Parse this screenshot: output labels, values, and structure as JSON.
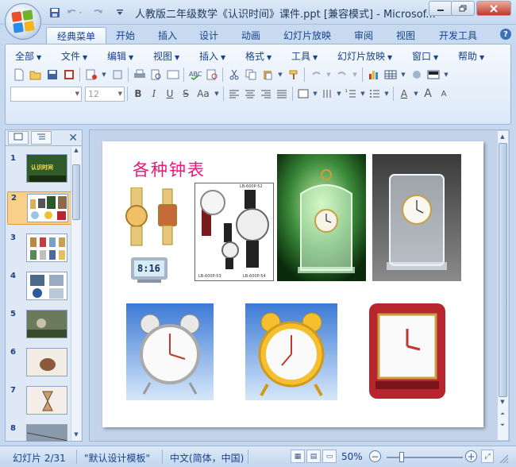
{
  "window": {
    "title": "人教版二年级数学《认识时间》课件.ppt [兼容模式] - Microsof..."
  },
  "qat": {
    "save_icon": "save-icon",
    "undo_icon": "undo-icon",
    "redo_icon": "redo-icon",
    "customize_icon": "dropdown-icon"
  },
  "ribbon_tabs": [
    "经典菜单",
    "开始",
    "插入",
    "设计",
    "动画",
    "幻灯片放映",
    "审阅",
    "视图",
    "开发工具"
  ],
  "menus": [
    "全部",
    "文件",
    "编辑",
    "视图",
    "插入",
    "格式",
    "工具",
    "幻灯片放映",
    "窗口",
    "帮助"
  ],
  "format_toolbar": {
    "font_name": "",
    "font_size": "12",
    "bold": "B",
    "italic": "I",
    "underline": "U",
    "strikethrough": "S",
    "change_case": "Aa",
    "grow_font": "A",
    "shrink_font": "A"
  },
  "slides_pane": {
    "tab_slides_icon": "slides-icon",
    "tab_outline_icon": "outline-icon",
    "close_label": "✕",
    "thumbnails": [
      {
        "num": "1",
        "text": "认识时间"
      },
      {
        "num": "2",
        "text": ""
      },
      {
        "num": "3",
        "text": ""
      },
      {
        "num": "4",
        "text": ""
      },
      {
        "num": "5",
        "text": ""
      },
      {
        "num": "6",
        "text": ""
      },
      {
        "num": "7",
        "text": ""
      },
      {
        "num": "8",
        "text": ""
      }
    ],
    "selected_index": 1
  },
  "slide": {
    "title": "各种钟表",
    "watch_labels": [
      "LB-600P-52",
      "LB-600P-53",
      "LB-600P-54"
    ],
    "digital_clock_time": "8:16"
  },
  "statusbar": {
    "slide_indicator": "幻灯片 2/31",
    "template": "\"默认设计模板\"",
    "language": "中文(简体，中国)",
    "zoom": "50%",
    "zoom_minus": "−",
    "zoom_plus": "+"
  },
  "colors": {
    "title_pink": "#e6197b",
    "ribbon_blue": "#15428b",
    "selected_thumb": "#f8d08a"
  }
}
